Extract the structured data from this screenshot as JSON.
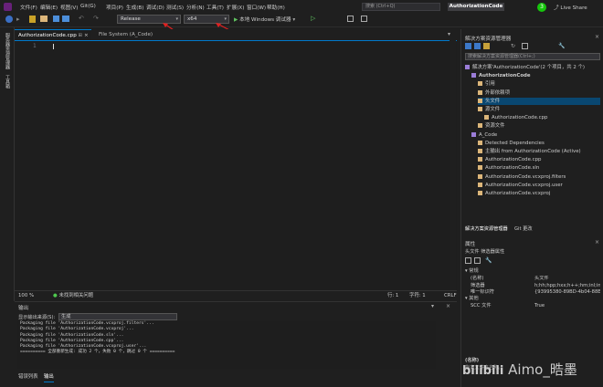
{
  "menu": [
    "文件(F)",
    "编辑(E)",
    "视图(V)",
    "Git(G)",
    "项目(P)",
    "生成(B)",
    "调试(D)",
    "测试(S)",
    "分析(N)",
    "工具(T)",
    "扩展(X)",
    "窗口(W)",
    "帮助(H)"
  ],
  "search": {
    "placeholder": "搜索 (Ctrl+Q)"
  },
  "solution_name": "AuthorizationCode",
  "notifications": "3",
  "liveshare": "Live Share",
  "toolbar": {
    "config": "Release",
    "platform": "x64",
    "run_label": "本地 Windows 调试器"
  },
  "left_strip": [
    "服务器资源管理器",
    "工具箱"
  ],
  "tabs": [
    {
      "label": "AuthorizationCode.cpp"
    },
    {
      "label": "File System (A_Code)"
    }
  ],
  "editor": {
    "line_number": "1"
  },
  "status": {
    "zoom": "100 %",
    "issues": "未找到相关问题",
    "line": "行: 1",
    "col": "字符: 1",
    "sel": "CRLF"
  },
  "output": {
    "title": "输出",
    "source_label": "显示输出来源(S):",
    "source_value": "生成",
    "lines": [
      "Packaging file 'AuthorizationCode.vcxproj.filters'...",
      "Packaging file 'AuthorizationCode.vcxproj'...",
      "Packaging file 'AuthorizationCode.sln'...",
      "Packaging file 'AuthorizationCode.cpp'...",
      "Packaging file 'AuthorizationCode.vcxproj.user'...",
      "========== 全部重新生成: 成功 2 个，失败 0 个，跳过 0 个 =========="
    ]
  },
  "bottom_tabs": [
    "错误列表",
    "输出"
  ],
  "solution_explorer": {
    "title": "解决方案资源管理器",
    "search": "搜索解决方案资源管理器(Ctrl+;)",
    "items": [
      {
        "label": "解决方案'AuthorizationCode'(2 个项目，共 2 个)",
        "indent": 0
      },
      {
        "label": "AuthorizationCode",
        "indent": 1,
        "bold": true
      },
      {
        "label": "引用",
        "indent": 2
      },
      {
        "label": "外部依赖项",
        "indent": 2
      },
      {
        "label": "头文件",
        "indent": 2,
        "selected": true
      },
      {
        "label": "源文件",
        "indent": 2
      },
      {
        "label": "AuthorizationCode.cpp",
        "indent": 3
      },
      {
        "label": "资源文件",
        "indent": 2
      },
      {
        "label": "A_Code",
        "indent": 1
      },
      {
        "label": "Detected Dependencies",
        "indent": 2
      },
      {
        "label": "主输出 from AuthorizationCode (Active)",
        "indent": 2
      },
      {
        "label": "AuthorizationCode.cpp",
        "indent": 2
      },
      {
        "label": "AuthorizationCode.sln",
        "indent": 2
      },
      {
        "label": "AuthorizationCode.vcxproj.filters",
        "indent": 2
      },
      {
        "label": "AuthorizationCode.vcxproj.user",
        "indent": 2
      },
      {
        "label": "AuthorizationCode.vcxproj",
        "indent": 2
      }
    ],
    "footer_tabs": [
      "解决方案资源管理器",
      "Git 更改"
    ]
  },
  "properties": {
    "title": "属性",
    "subject": "头文件 筛选器属性",
    "section1": "常规",
    "rows": [
      {
        "k": "(名称)",
        "v": "头文件"
      },
      {
        "k": "筛选器",
        "v": "h;hh;hpp;hxx;h++;hm;inl;inc;ip"
      },
      {
        "k": "唯一标识符",
        "v": "{93995380-89BD-4b04-88EB-625"
      }
    ],
    "section2": "其他",
    "rows2": [
      {
        "k": "SCC 文件",
        "v": "True"
      }
    ],
    "footer": "(名称)",
    "footer_desc": "指定文件夹名称。"
  },
  "watermark": "Aimo_晧墨"
}
